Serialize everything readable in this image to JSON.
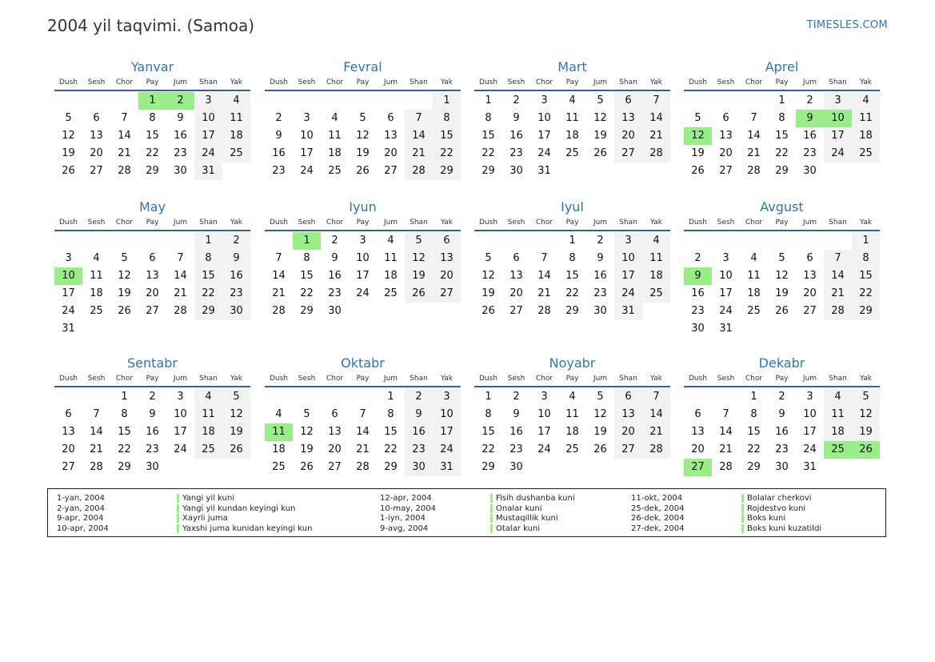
{
  "header": {
    "title": "2004 yil taqvimi. (Samoa)",
    "brand": "TIMESLES.COM"
  },
  "weekdays": [
    "Dush",
    "Sesh",
    "Chor",
    "Pay",
    "Jum",
    "Shan",
    "Yak"
  ],
  "months": [
    {
      "name": "Yanvar",
      "offset": 3,
      "days": 31,
      "holidays": [
        1,
        2
      ]
    },
    {
      "name": "Fevral",
      "offset": 6,
      "days": 29,
      "holidays": []
    },
    {
      "name": "Mart",
      "offset": 0,
      "days": 31,
      "holidays": []
    },
    {
      "name": "Aprel",
      "offset": 3,
      "days": 30,
      "holidays": [
        9,
        10,
        12
      ]
    },
    {
      "name": "May",
      "offset": 5,
      "days": 31,
      "holidays": [
        10
      ]
    },
    {
      "name": "Iyun",
      "offset": 1,
      "days": 30,
      "holidays": [
        1
      ]
    },
    {
      "name": "Iyul",
      "offset": 3,
      "days": 31,
      "holidays": []
    },
    {
      "name": "Avgust",
      "offset": 6,
      "days": 31,
      "holidays": [
        9
      ]
    },
    {
      "name": "Sentabr",
      "offset": 2,
      "days": 30,
      "holidays": []
    },
    {
      "name": "Oktabr",
      "offset": 4,
      "days": 31,
      "holidays": [
        11
      ]
    },
    {
      "name": "Noyabr",
      "offset": 0,
      "days": 30,
      "holidays": []
    },
    {
      "name": "Dekabr",
      "offset": 2,
      "days": 31,
      "holidays": [
        25,
        26,
        27
      ]
    }
  ],
  "legend": [
    {
      "date": "1-yan, 2004",
      "name": "Yangi yil kuni"
    },
    {
      "date": "2-yan, 2004",
      "name": "Yangi yil kundan keyingi kun"
    },
    {
      "date": "9-apr, 2004",
      "name": "Xayrli juma"
    },
    {
      "date": "10-apr, 2004",
      "name": "Yaxshi juma kunidan keyingi kun"
    },
    {
      "date": "12-apr, 2004",
      "name": "Fisih dushanba kuni"
    },
    {
      "date": "10-may, 2004",
      "name": "Onalar kuni"
    },
    {
      "date": "1-iyn, 2004",
      "name": "Mustaqillik kuni"
    },
    {
      "date": "9-avg, 2004",
      "name": "Otalar kuni"
    },
    {
      "date": "11-okt, 2004",
      "name": "Bolalar cherkovi"
    },
    {
      "date": "25-dek, 2004",
      "name": "Rojdestvo kuni"
    },
    {
      "date": "26-dek, 2004",
      "name": "Boks kuni"
    },
    {
      "date": "27-dek, 2004",
      "name": "Boks kuni kuzatildi"
    }
  ]
}
